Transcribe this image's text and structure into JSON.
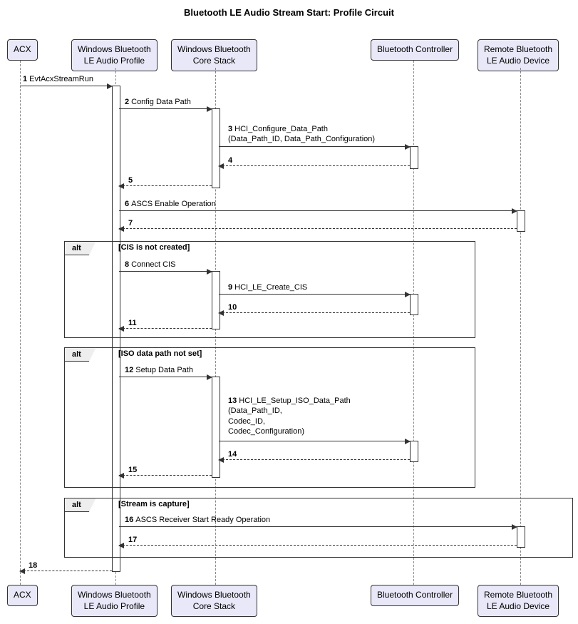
{
  "title": "Bluetooth LE Audio Stream Start: Profile Circuit",
  "participants": {
    "acx": "ACX",
    "profile": "Windows Bluetooth\nLE Audio Profile",
    "stack": "Windows Bluetooth\nCore Stack",
    "controller": "Bluetooth Controller",
    "remote": "Remote Bluetooth\nLE Audio Device"
  },
  "messages": {
    "m1": {
      "n": "1",
      "t": "EvtAcxStreamRun"
    },
    "m2": {
      "n": "2",
      "t": "Config Data Path"
    },
    "m3": {
      "n": "3",
      "t": "HCI_Configure_Data_Path\n(Data_Path_ID, Data_Path_Configuration)"
    },
    "m4": {
      "n": "4",
      "t": ""
    },
    "m5": {
      "n": "5",
      "t": ""
    },
    "m6": {
      "n": "6",
      "t": "ASCS Enable Operation"
    },
    "m7": {
      "n": "7",
      "t": ""
    },
    "m8": {
      "n": "8",
      "t": "Connect CIS"
    },
    "m9": {
      "n": "9",
      "t": "HCI_LE_Create_CIS"
    },
    "m10": {
      "n": "10",
      "t": ""
    },
    "m11": {
      "n": "11",
      "t": ""
    },
    "m12": {
      "n": "12",
      "t": "Setup Data Path"
    },
    "m13": {
      "n": "13",
      "t": "HCI_LE_Setup_ISO_Data_Path\n(Data_Path_ID,\nCodec_ID,\nCodec_Configuration)"
    },
    "m14": {
      "n": "14",
      "t": ""
    },
    "m15": {
      "n": "15",
      "t": ""
    },
    "m16": {
      "n": "16",
      "t": "ASCS Receiver Start Ready Operation"
    },
    "m17": {
      "n": "17",
      "t": ""
    },
    "m18": {
      "n": "18",
      "t": ""
    }
  },
  "alt": {
    "label": "alt",
    "g1": "[CIS is not created]",
    "g2": "[ISO data path not set]",
    "g3": "[Stream is capture]"
  }
}
